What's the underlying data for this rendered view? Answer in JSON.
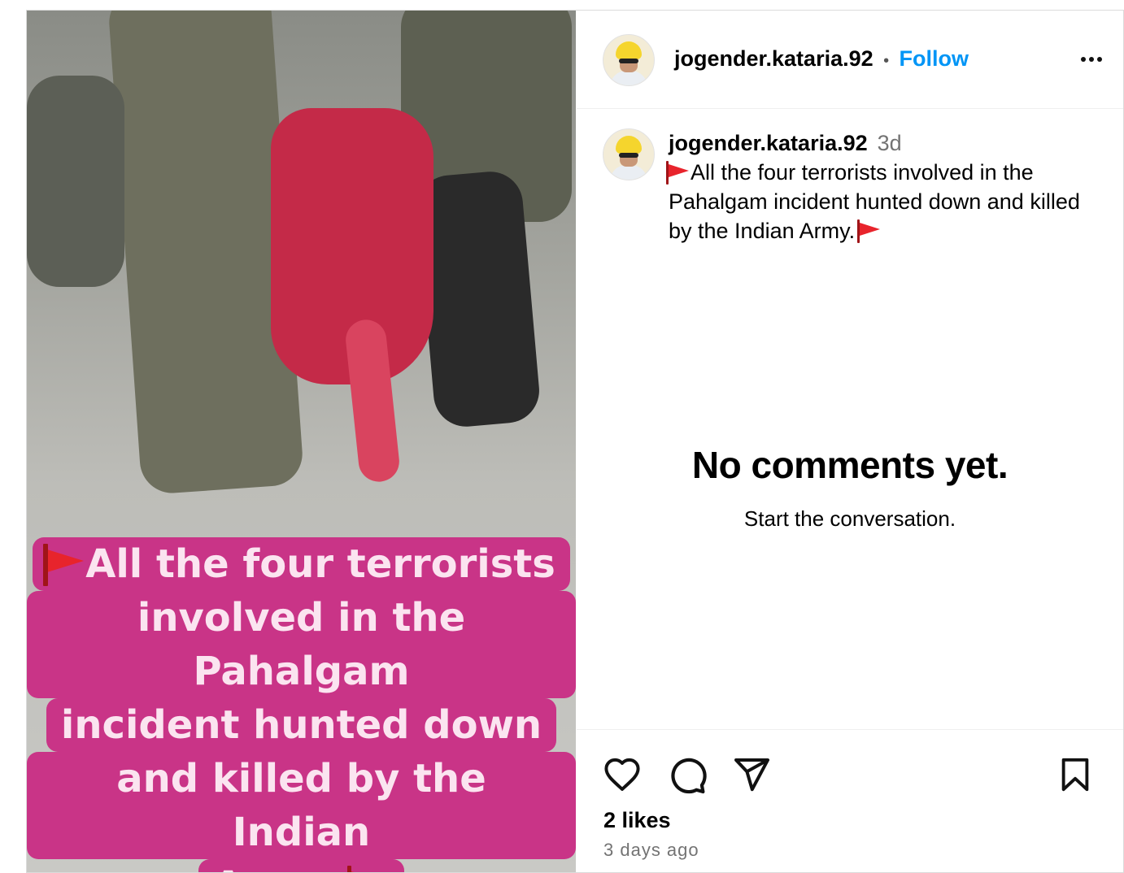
{
  "post": {
    "media": {
      "overlay_lines": [
        "All the four terrorists",
        "involved in the Pahalgam",
        "incident hunted down",
        "and killed by the Indian",
        "Army."
      ],
      "overlay_color": "#c93487",
      "overlay_text_color": "#fbe4f0",
      "flag_icon": "red-triangular-flag-emoji"
    },
    "header": {
      "username": "jogender.kataria.92",
      "separator": "•",
      "follow_label": "Follow",
      "more_icon": "more-options-icon"
    },
    "caption": {
      "username": "jogender.kataria.92",
      "time": "3d",
      "text": "All the four terrorists involved in the Pahalgam incident hunted down and killed by the Indian Army."
    },
    "comments": {
      "empty_title": "No comments yet.",
      "empty_subtitle": "Start the conversation."
    },
    "actions": {
      "like_icon": "heart-icon",
      "comment_icon": "comment-icon",
      "share_icon": "share-icon",
      "save_icon": "bookmark-icon"
    },
    "likes": "2 likes",
    "timestamp": "3 days ago",
    "colors": {
      "accent": "#0095f6",
      "muted": "#737373",
      "border": "#dbdbdb"
    }
  }
}
